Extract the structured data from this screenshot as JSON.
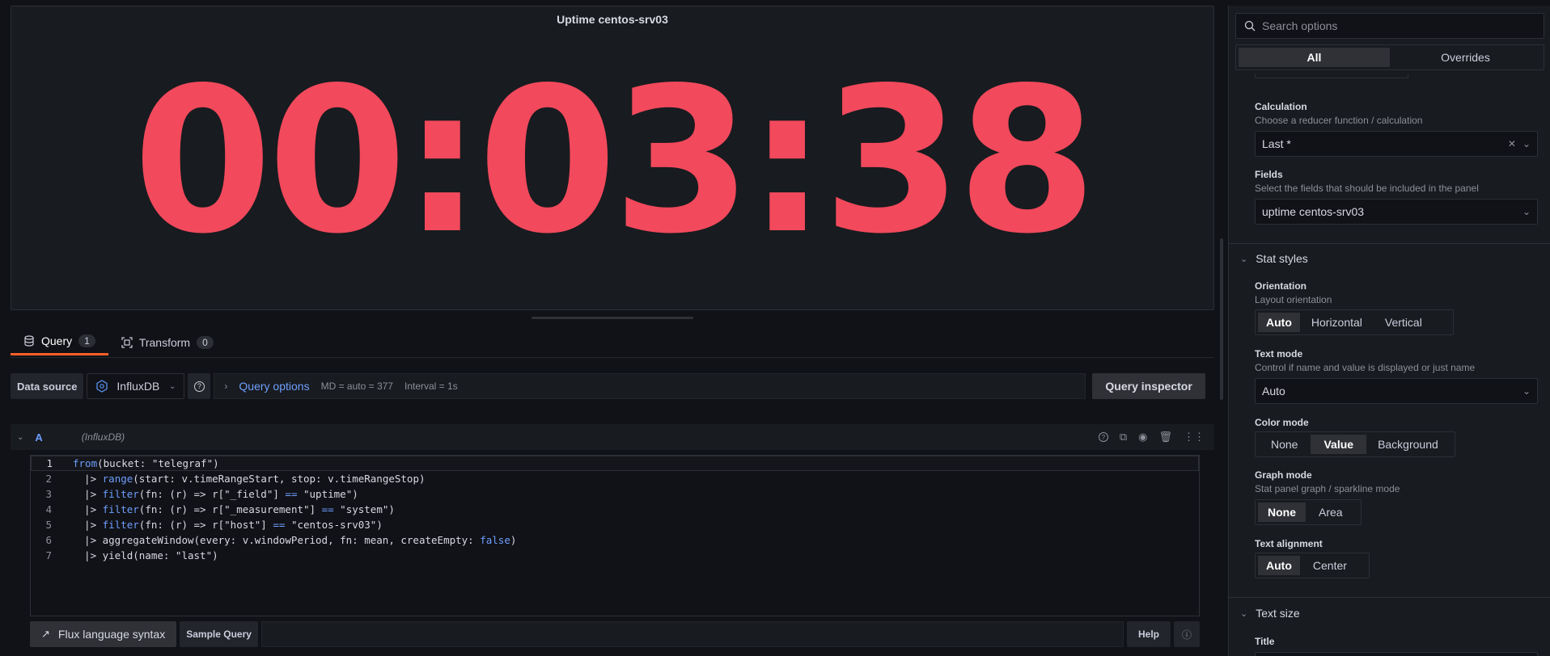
{
  "panel": {
    "title": "Uptime centos-srv03",
    "value": "00:03:38",
    "value_color": "#f2495c"
  },
  "tabs": [
    {
      "label": "Query",
      "count": "1"
    },
    {
      "label": "Transform",
      "count": "0"
    }
  ],
  "datasource": {
    "label": "Data source",
    "name": "InfluxDB",
    "query_options_label": "Query options",
    "md": "MD = auto = 377",
    "interval": "Interval = 1s",
    "inspector_label": "Query inspector"
  },
  "query": {
    "letter": "A",
    "ds_name": "(InfluxDB)",
    "lines": [
      {
        "n": "1",
        "parts": [
          {
            "t": "from",
            "kw": true
          },
          {
            "t": "(bucket: \"telegraf\")"
          }
        ]
      },
      {
        "n": "2",
        "parts": [
          {
            "t": "  |> "
          },
          {
            "t": "range",
            "kw": true
          },
          {
            "t": "(start: v.timeRangeStart, stop: v.timeRangeStop)"
          }
        ]
      },
      {
        "n": "3",
        "parts": [
          {
            "t": "  |> "
          },
          {
            "t": "filter",
            "kw": true
          },
          {
            "t": "(fn: (r) => r[\"_field\"] "
          },
          {
            "t": "==",
            "kw": true
          },
          {
            "t": " \"uptime\")"
          }
        ]
      },
      {
        "n": "4",
        "parts": [
          {
            "t": "  |> "
          },
          {
            "t": "filter",
            "kw": true
          },
          {
            "t": "(fn: (r) => r[\"_measurement\"] "
          },
          {
            "t": "==",
            "kw": true
          },
          {
            "t": " \"system\")"
          }
        ]
      },
      {
        "n": "5",
        "parts": [
          {
            "t": "  |> "
          },
          {
            "t": "filter",
            "kw": true
          },
          {
            "t": "(fn: (r) => r[\"host\"] "
          },
          {
            "t": "==",
            "kw": true
          },
          {
            "t": " \"centos-srv03\")"
          }
        ]
      },
      {
        "n": "6",
        "parts": [
          {
            "t": "  |> aggregateWindow(every: v.windowPeriod, fn: mean, createEmpty: "
          },
          {
            "t": "false",
            "kw": true
          },
          {
            "t": ")"
          }
        ]
      },
      {
        "n": "7",
        "parts": [
          {
            "t": "  |> yield(name: \"last\")"
          }
        ]
      }
    ],
    "flux_syntax_label": "Flux language syntax",
    "sample_query_label": "Sample Query",
    "help_label": "Help"
  },
  "options": {
    "search_placeholder": "Search options",
    "filter_all": "All",
    "filter_overrides": "Overrides",
    "calculation": {
      "title": "Calculation",
      "desc": "Choose a reducer function / calculation",
      "value": "Last *"
    },
    "fields": {
      "title": "Fields",
      "desc": "Select the fields that should be included in the panel",
      "value": "uptime centos-srv03"
    },
    "stat_styles_title": "Stat styles",
    "orientation": {
      "title": "Orientation",
      "desc": "Layout orientation",
      "options": [
        "Auto",
        "Horizontal",
        "Vertical"
      ],
      "selected": "Auto"
    },
    "text_mode": {
      "title": "Text mode",
      "desc": "Control if name and value is displayed or just name",
      "value": "Auto"
    },
    "color_mode": {
      "title": "Color mode",
      "options": [
        "None",
        "Value",
        "Background"
      ],
      "selected": "Value"
    },
    "graph_mode": {
      "title": "Graph mode",
      "desc": "Stat panel graph / sparkline mode",
      "options": [
        "None",
        "Area"
      ],
      "selected": "None"
    },
    "text_alignment": {
      "title": "Text alignment",
      "options": [
        "Auto",
        "Center"
      ],
      "selected": "Auto"
    },
    "text_size_title": "Text size",
    "title_label": "Title"
  }
}
